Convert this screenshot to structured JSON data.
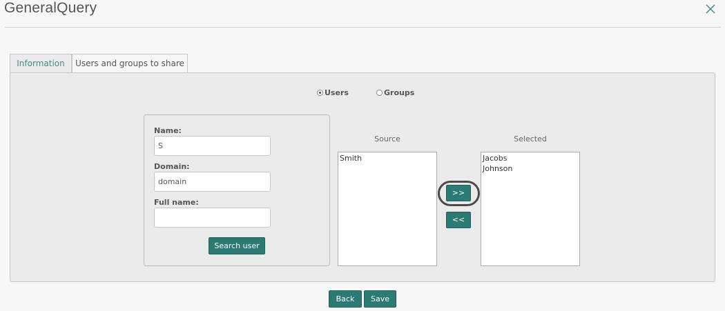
{
  "window": {
    "title": "GeneralQuery"
  },
  "tabs": [
    {
      "label": "Information"
    },
    {
      "label": "Users and groups to share"
    }
  ],
  "mode": {
    "users_label": "Users",
    "groups_label": "Groups",
    "selected": "Users"
  },
  "search": {
    "name_label": "Name:",
    "name_value": "S",
    "domain_label": "Domain:",
    "domain_value": "domain",
    "fullname_label": "Full name:",
    "fullname_value": "",
    "button_label": "Search user"
  },
  "source": {
    "title": "Source",
    "items": [
      "Smith"
    ]
  },
  "selected": {
    "title": "Selected",
    "items": [
      "Jacobs",
      "Johnson"
    ]
  },
  "transfer": {
    "add_label": ">>",
    "remove_label": "<<"
  },
  "footer": {
    "back_label": "Back",
    "save_label": "Save"
  },
  "colors": {
    "accent": "#2b7a74",
    "active_tab_text": "#3f8f86"
  },
  "icons": {
    "close": "close-icon"
  }
}
